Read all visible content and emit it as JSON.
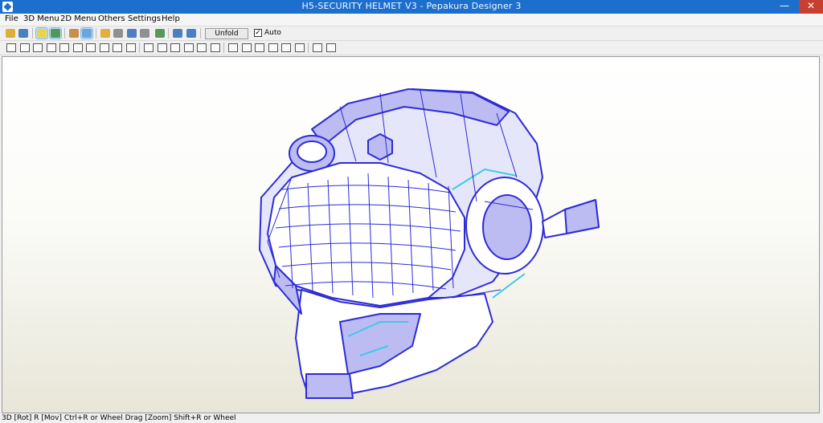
{
  "window": {
    "title": "H5-SECURITY HELMET V3 - Pepakura Designer 3",
    "minimize_glyph": "—",
    "close_glyph": "✕"
  },
  "menu": [
    {
      "label": "File"
    },
    {
      "label": "3D Menu"
    },
    {
      "label": "2D Menu"
    },
    {
      "label": "Others"
    },
    {
      "label": "Settings"
    },
    {
      "label": "Help"
    }
  ],
  "toolbar1": {
    "icons": [
      {
        "name": "open-file-icon",
        "color": "#d9a21b"
      },
      {
        "name": "save-icon",
        "color": "#2f6bb8"
      },
      {
        "name": "light-bulb-icon",
        "color": "#f1d12a",
        "active": true
      },
      {
        "name": "texture-cube-icon",
        "color": "#3c8a3b",
        "active": true
      },
      {
        "name": "box-icon",
        "color": "#c27c2b"
      },
      {
        "name": "paper-plane-icon",
        "color": "#5b9bd5",
        "active": true
      },
      {
        "name": "pencil-icon",
        "color": "#e2a21f"
      },
      {
        "name": "cylinder-icon",
        "color": "#7f7f7f"
      },
      {
        "name": "anchor-icon",
        "color": "#2f6bb8"
      },
      {
        "name": "parts-icon",
        "color": "#7f7f7f"
      },
      {
        "name": "globe-icon",
        "color": "#3c8a3b"
      },
      {
        "name": "window-single-icon",
        "color": "#2f6bb8"
      },
      {
        "name": "window-split-icon",
        "color": "#2f6bb8"
      }
    ],
    "unfold_label": "Unfold",
    "auto_label": "Auto",
    "auto_checked": true,
    "check_glyph": "✓"
  },
  "toolbar2": {
    "icons": [
      {
        "name": "select-icon"
      },
      {
        "name": "rotate-icon"
      },
      {
        "name": "flap-icon"
      },
      {
        "name": "join-edge-icon"
      },
      {
        "name": "split-icon"
      },
      {
        "name": "text-icon"
      },
      {
        "name": "image-icon"
      },
      {
        "name": "move-icon"
      },
      {
        "name": "undo-icon"
      },
      {
        "name": "redo-icon"
      },
      {
        "name": "layout-icon"
      },
      {
        "name": "layout-grid-icon"
      },
      {
        "name": "layout-part-icon"
      },
      {
        "name": "page-icon"
      },
      {
        "name": "print-icon"
      },
      {
        "name": "page-setup-icon"
      },
      {
        "name": "align-left-icon"
      },
      {
        "name": "align-center-icon"
      },
      {
        "name": "align-right-icon"
      },
      {
        "name": "align-top-icon"
      },
      {
        "name": "align-middle-icon"
      },
      {
        "name": "align-bottom-icon"
      },
      {
        "name": "zoom-in-icon"
      },
      {
        "name": "zoom-out-icon"
      }
    ]
  },
  "viewport": {
    "model_fill": "#ffffff",
    "model_edge": "#2d2bd6",
    "model_shade": "#bcbcf2",
    "accent_cyan": "#3ec9e8"
  },
  "status": {
    "text": "3D [Rot] R [Mov] Ctrl+R or Wheel Drag [Zoom] Shift+R or Wheel"
  }
}
